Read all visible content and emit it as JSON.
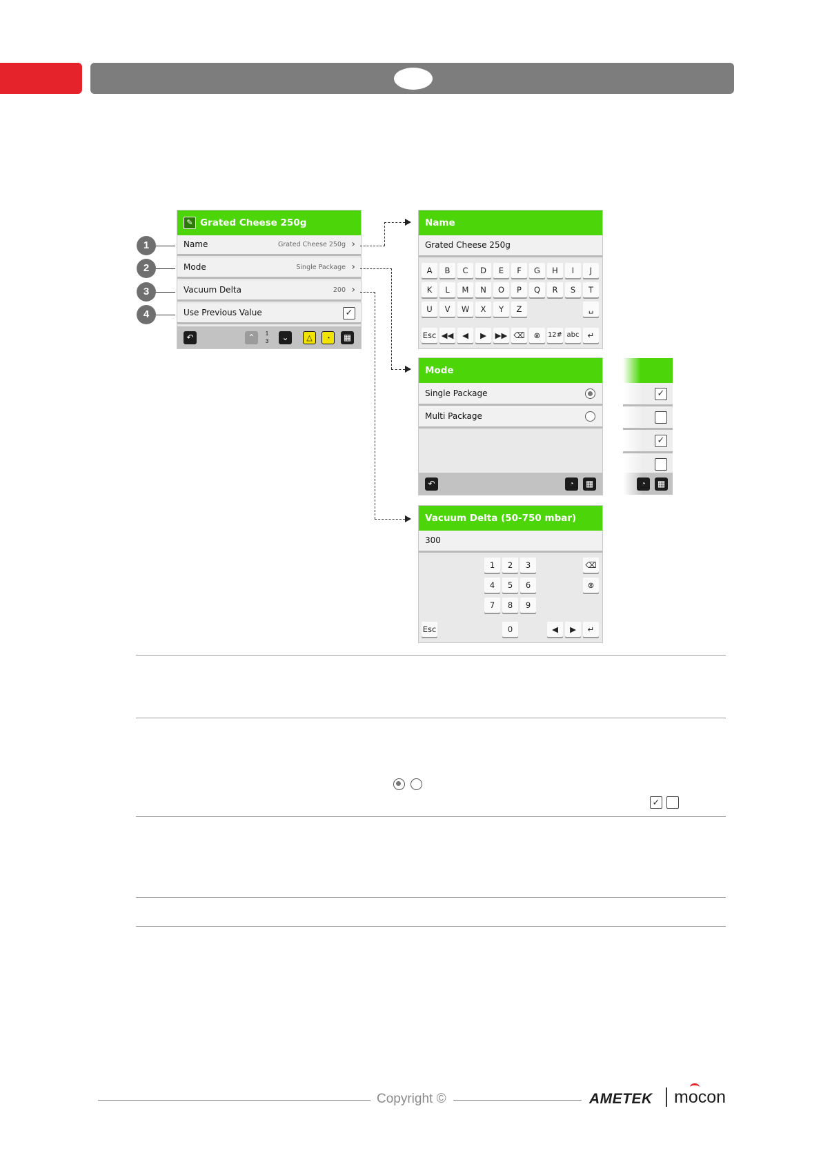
{
  "header": {
    "page_number": ""
  },
  "main_screen": {
    "title": "Grated Cheese 250g",
    "rows": [
      {
        "label": "Name",
        "value": "Grated Cheese 250g"
      },
      {
        "label": "Mode",
        "value": "Single Package"
      },
      {
        "label": "Vacuum Delta",
        "value": "200"
      },
      {
        "label": "Use Previous Value",
        "value": ""
      }
    ],
    "page_indicator": {
      "current": "1",
      "total": "3"
    }
  },
  "callouts": [
    "1",
    "2",
    "3",
    "4"
  ],
  "name_screen": {
    "title": "Name",
    "value": "Grated Cheese 250g",
    "keys_row1": [
      "A",
      "B",
      "C",
      "D",
      "E",
      "F",
      "G",
      "H",
      "I",
      "J"
    ],
    "keys_row2": [
      "K",
      "L",
      "M",
      "N",
      "O",
      "P",
      "Q",
      "R",
      "S",
      "T"
    ],
    "keys_row3": [
      "U",
      "V",
      "W",
      "X",
      "Y",
      "Z"
    ],
    "esc": "Esc",
    "num_toggle": "12#",
    "abc_toggle": "abc"
  },
  "mode_screen": {
    "title": "Mode",
    "options": [
      {
        "label": "Single Package",
        "selected": true
      },
      {
        "label": "Multi Package",
        "selected": false
      }
    ],
    "side_checkboxes": [
      true,
      false,
      true,
      false
    ]
  },
  "vacuum_screen": {
    "title": "Vacuum Delta (50-750 mbar)",
    "value": "300",
    "keys": [
      "1",
      "2",
      "3",
      "4",
      "5",
      "6",
      "7",
      "8",
      "9"
    ],
    "zero": "0",
    "esc": "Esc"
  },
  "footer": {
    "copyright": "Copyright ©",
    "brand1": "AMETEK",
    "brand2": "mocon"
  },
  "colors": {
    "accent_red": "#e4232b",
    "header_grey": "#7d7d7d",
    "screen_green": "#4cd60a"
  }
}
